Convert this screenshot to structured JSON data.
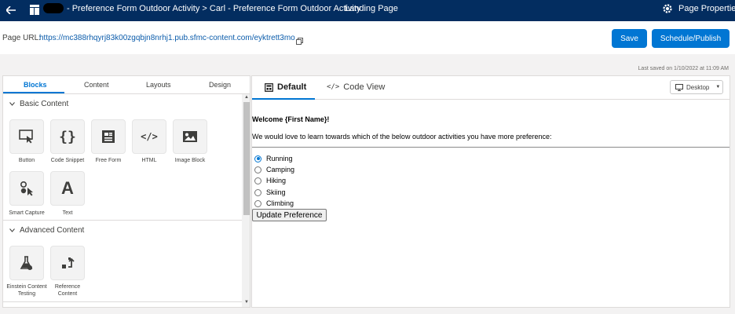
{
  "topbar": {
    "breadcrumb": "- Preference Form Outdoor Activity > Carl - Preference Form Outdoor Activity",
    "landing": "Landing Page",
    "page_properties": "Page Properties"
  },
  "urlbar": {
    "label": "Page URL:",
    "url": "https://mc388rhqyrj83k00zgqbjn8nrhj1.pub.sfmc-content.com/eyktrett3mo",
    "save": "Save",
    "publish": "Schedule/Publish"
  },
  "saved_status": "Last saved on 1/10/2022 at 11:09 AM",
  "left_tabs": [
    "Blocks",
    "Content",
    "Layouts",
    "Design"
  ],
  "basic_content": {
    "heading": "Basic Content",
    "items": [
      "Button",
      "Code Snippet",
      "Free Form",
      "HTML",
      "Image Block",
      "Smart Capture",
      "Text"
    ]
  },
  "advanced_content": {
    "heading": "Advanced Content",
    "items": [
      "Einstein Content Testing",
      "Reference Content"
    ]
  },
  "right_tabs": {
    "default": "Default",
    "code_view": "Code View"
  },
  "device_select": "Desktop",
  "canvas": {
    "welcome": "Welcome {First Name}!",
    "intro": "We would love to learn towards which of the below outdoor activities you have more preference:",
    "options": [
      "Running",
      "Camping",
      "Hiking",
      "Skiing",
      "Climbing"
    ],
    "selected": "Running",
    "button": "Update Preference"
  },
  "colors": {
    "topbar": "#032d60",
    "accent": "#0176d3"
  }
}
